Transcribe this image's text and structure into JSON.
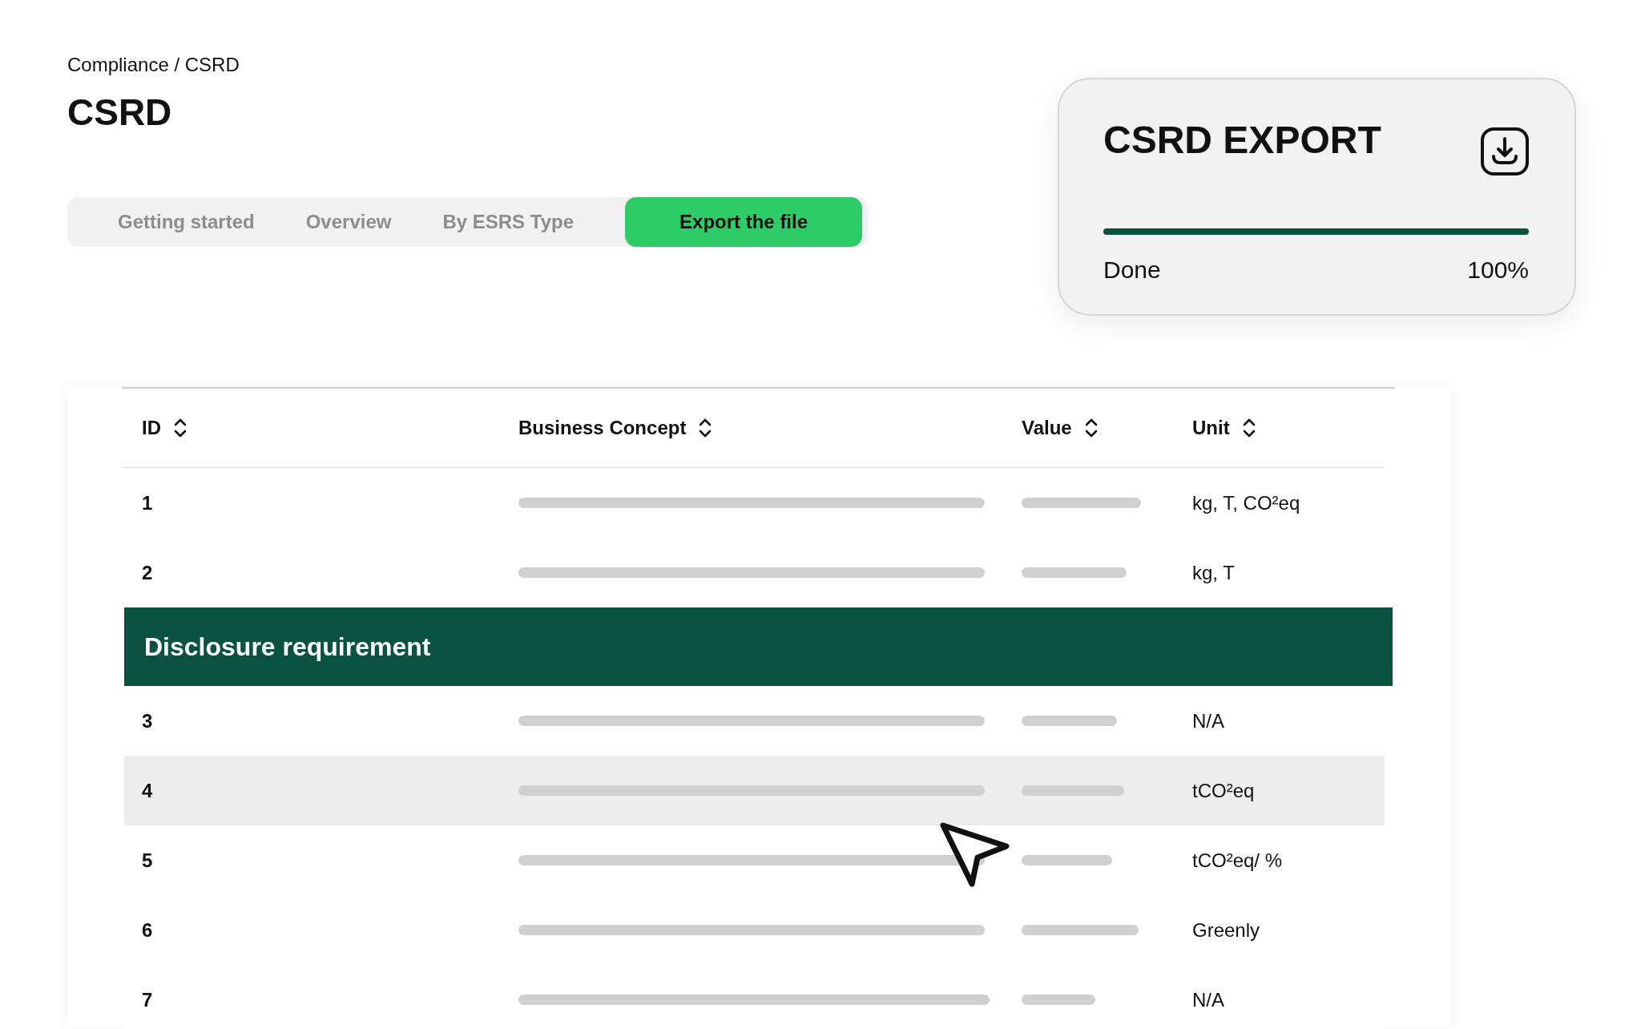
{
  "breadcrumb": "Compliance / CSRD",
  "title": "CSRD",
  "tabs": [
    {
      "label": "Getting started",
      "selected": false
    },
    {
      "label": "Overview",
      "selected": false
    },
    {
      "label": "By ESRS Type",
      "selected": false
    },
    {
      "label": "Export the file",
      "selected": true
    }
  ],
  "export_card": {
    "title": "CSRD EXPORT",
    "progress": {
      "level": 1.0,
      "status": "Done",
      "percent": "100%"
    }
  },
  "table": {
    "columns": [
      "ID",
      "Business Concept",
      "Value",
      "Unit"
    ],
    "rows": [
      {
        "kind": "row",
        "id": "1",
        "unit": "kg, T, CO²eq",
        "selected": false
      },
      {
        "kind": "row",
        "id": "2",
        "unit": "kg, T",
        "selected": false
      },
      {
        "kind": "group",
        "label": "Disclosure requirement"
      },
      {
        "kind": "row",
        "id": "3",
        "unit": "N/A",
        "selected": false
      },
      {
        "kind": "row",
        "id": "4",
        "unit": "tCO²eq",
        "selected": true
      },
      {
        "kind": "row",
        "id": "5",
        "unit": "tCO²eq/ %",
        "selected": false
      },
      {
        "kind": "row",
        "id": "6",
        "unit": "Greenly",
        "selected": false
      },
      {
        "kind": "row",
        "id": "7",
        "unit": "N/A",
        "selected": false
      }
    ]
  }
}
